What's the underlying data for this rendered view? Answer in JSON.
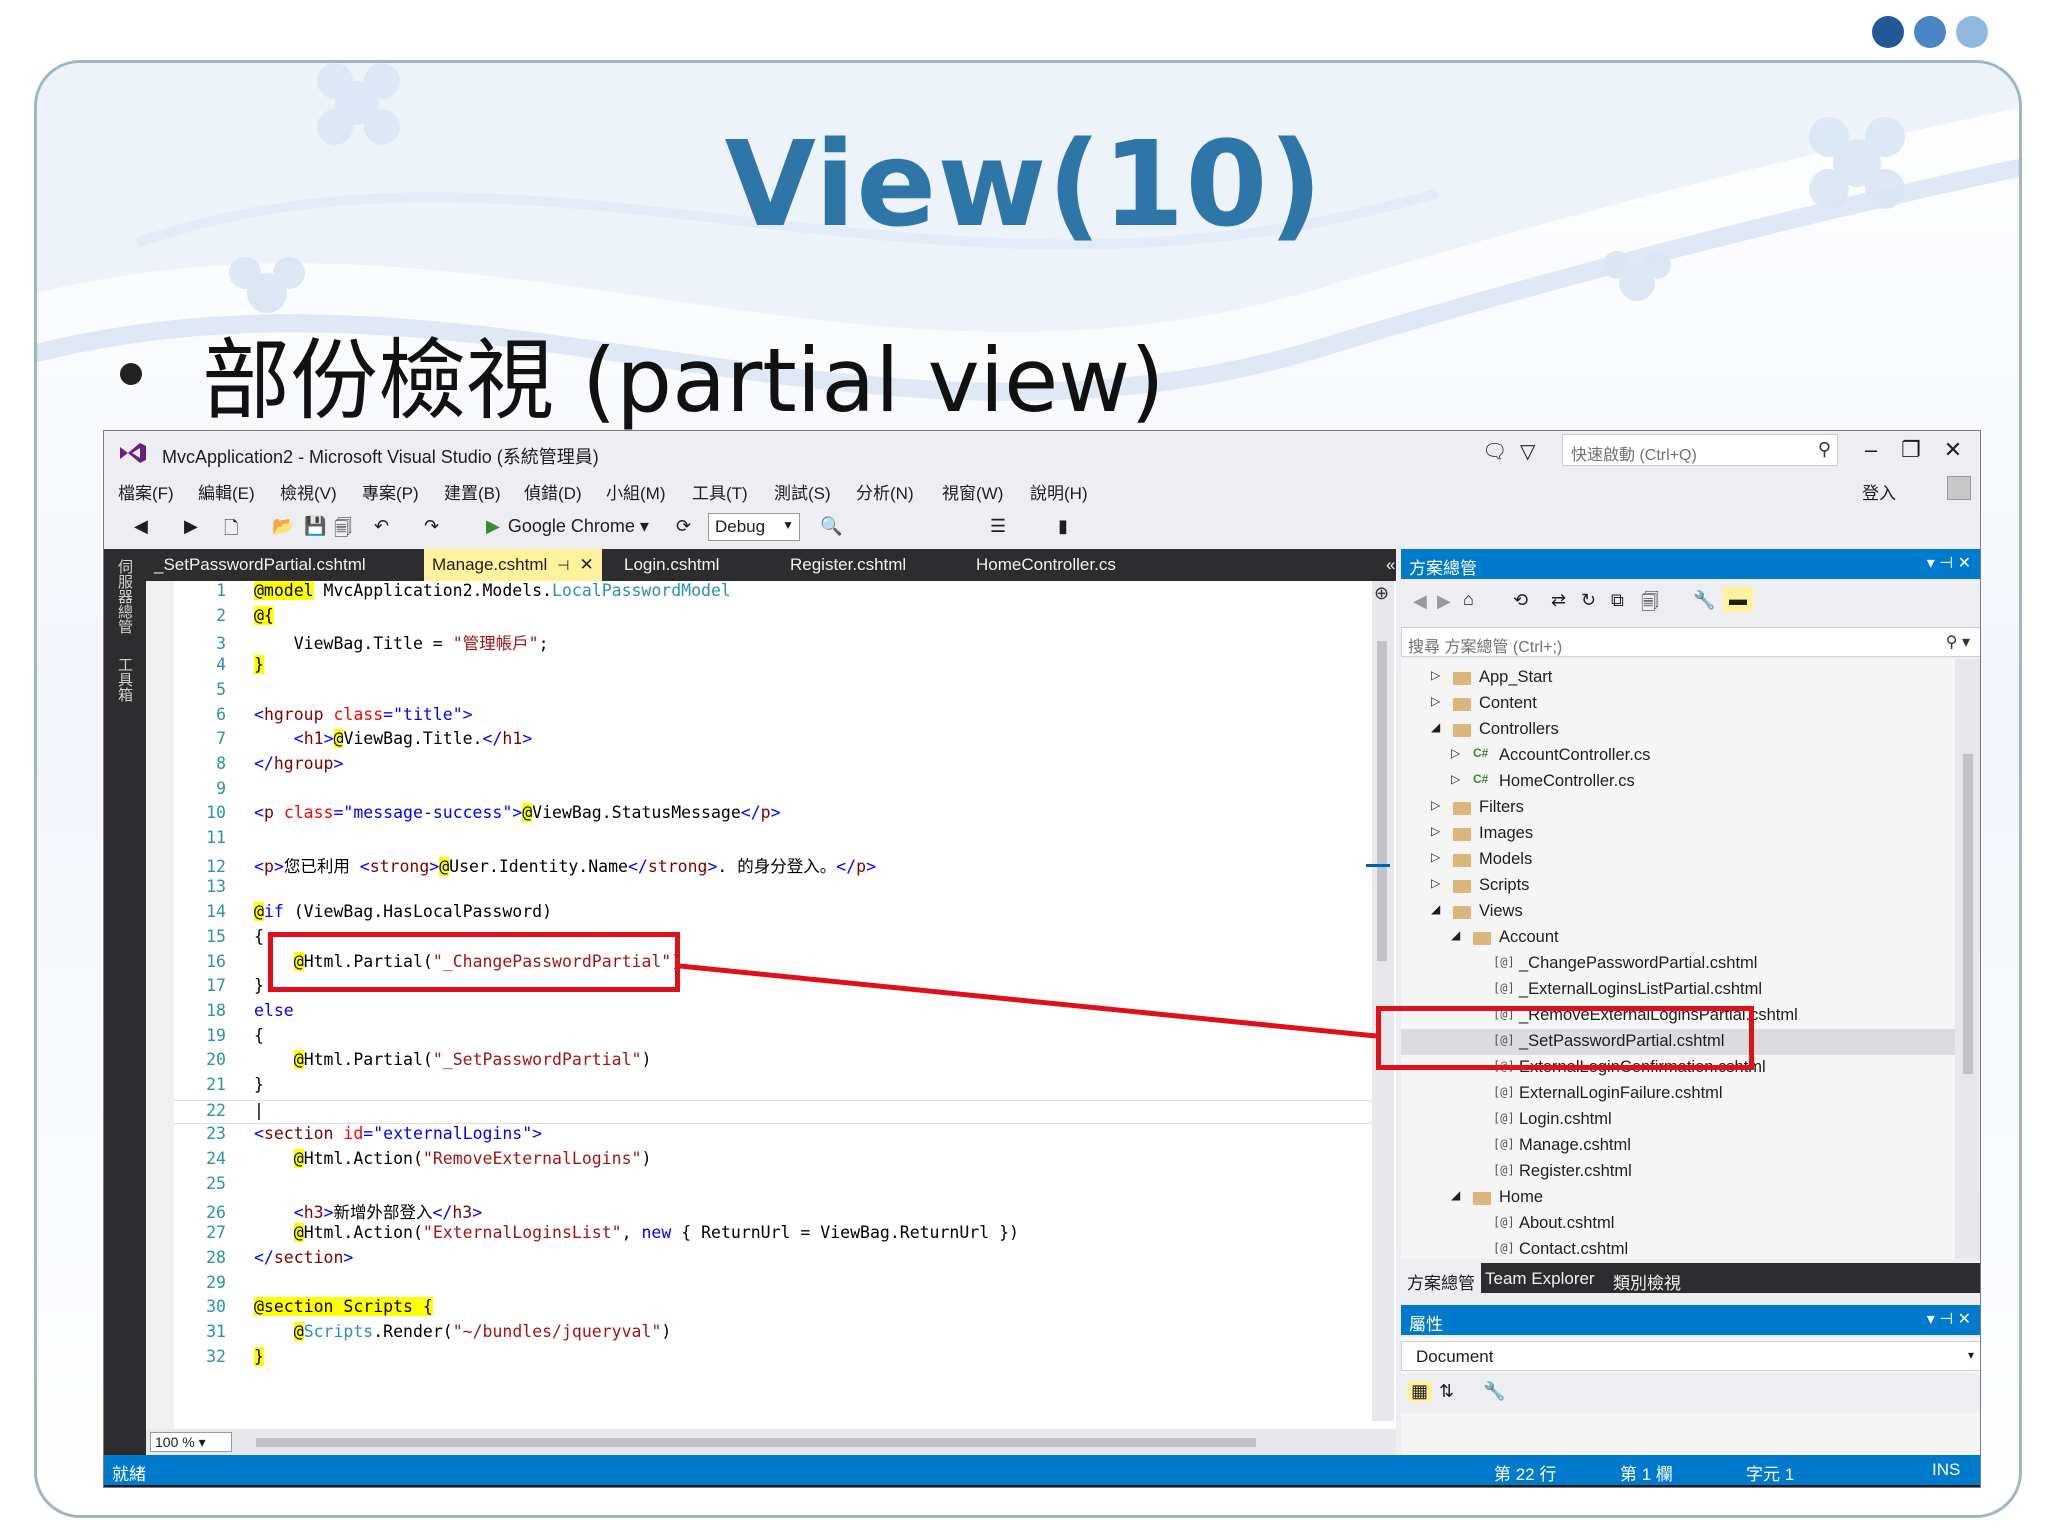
{
  "slide": {
    "title": "View(10)",
    "bullet": "部份檢視 (partial view)",
    "dots_colors": [
      "#1f5a96",
      "#4a86c5",
      "#8fb9e0"
    ]
  },
  "window": {
    "title": "MvcApplication2 - Microsoft Visual Studio (系統管理員)",
    "quick_launch_placeholder": "快速啟動 (Ctrl+Q)",
    "sign_in": "登入",
    "menu": [
      "檔案(F)",
      "編輯(E)",
      "檢視(V)",
      "專案(P)",
      "建置(B)",
      "偵錯(D)",
      "小組(M)",
      "工具(T)",
      "測試(S)",
      "分析(N)",
      "視窗(W)",
      "說明(H)"
    ],
    "toolbar": {
      "run_target": "Google Chrome",
      "configuration": "Debug"
    },
    "left_strip": [
      "伺服器總管",
      "工具箱"
    ]
  },
  "editor": {
    "tabs": [
      "_SetPasswordPartial.cshtml",
      "Manage.cshtml",
      "Login.cshtml",
      "Register.cshtml",
      "HomeController.cs"
    ],
    "active_tab": "Manage.cshtml",
    "zoom": "100 %",
    "lines": {
      "l1": "@model MvcApplication2.Models.LocalPasswordModel",
      "l2": "@{",
      "l3": "    ViewBag.Title = \"管理帳戶\";",
      "l4": "}",
      "l6": "<hgroup class=\"title\">",
      "l7": "    <h1>@ViewBag.Title.</h1>",
      "l8": "</hgroup>",
      "l10": "<p class=\"message-success\">@ViewBag.StatusMessage</p>",
      "l12": "<p>您已利用 <strong>@User.Identity.Name</strong>. 的身分登入。</p>",
      "l14": "@if (ViewBag.HasLocalPassword)",
      "l15": "{",
      "l16": "    @Html.Partial(\"_ChangePasswordPartial\")",
      "l17": "}",
      "l18": "else",
      "l19": "{",
      "l20": "    @Html.Partial(\"_SetPasswordPartial\")",
      "l21": "}",
      "l23": "<section id=\"externalLogins\">",
      "l24": "    @Html.Action(\"RemoveExternalLogins\")",
      "l26": "    <h3>新增外部登入</h3>",
      "l27": "    @Html.Action(\"ExternalLoginsList\", new { ReturnUrl = ViewBag.ReturnUrl })",
      "l28": "</section>",
      "l30": "@section Scripts {",
      "l31": "    @Scripts.Render(\"~/bundles/jqueryval\")",
      "l32": "}"
    }
  },
  "solution_explorer": {
    "title": "方案總管",
    "search_placeholder": "搜尋 方案總管 (Ctrl+;)",
    "items": [
      {
        "label": "App_Start",
        "kind": "folder",
        "level": 0,
        "state": "collapsed"
      },
      {
        "label": "Content",
        "kind": "folder",
        "level": 0,
        "state": "collapsed"
      },
      {
        "label": "Controllers",
        "kind": "folder",
        "level": 0,
        "state": "expanded"
      },
      {
        "label": "AccountController.cs",
        "kind": "cs",
        "level": 1,
        "state": "collapsed"
      },
      {
        "label": "HomeController.cs",
        "kind": "cs",
        "level": 1,
        "state": "collapsed"
      },
      {
        "label": "Filters",
        "kind": "folder",
        "level": 0,
        "state": "collapsed"
      },
      {
        "label": "Images",
        "kind": "folder",
        "level": 0,
        "state": "collapsed"
      },
      {
        "label": "Models",
        "kind": "folder",
        "level": 0,
        "state": "collapsed"
      },
      {
        "label": "Scripts",
        "kind": "folder",
        "level": 0,
        "state": "collapsed"
      },
      {
        "label": "Views",
        "kind": "folder",
        "level": 0,
        "state": "expanded"
      },
      {
        "label": "Account",
        "kind": "folder",
        "level": 1,
        "state": "expanded"
      },
      {
        "label": "_ChangePasswordPartial.cshtml",
        "kind": "cshtml",
        "level": 2,
        "state": "none"
      },
      {
        "label": "_ExternalLoginsListPartial.cshtml",
        "kind": "cshtml",
        "level": 2,
        "state": "none"
      },
      {
        "label": "_RemoveExternalLoginsPartial.cshtml",
        "kind": "cshtml",
        "level": 2,
        "state": "none"
      },
      {
        "label": "_SetPasswordPartial.cshtml",
        "kind": "cshtml",
        "level": 2,
        "state": "selected"
      },
      {
        "label": "ExternalLoginConfirmation.cshtml",
        "kind": "cshtml",
        "level": 2,
        "state": "none"
      },
      {
        "label": "ExternalLoginFailure.cshtml",
        "kind": "cshtml",
        "level": 2,
        "state": "none"
      },
      {
        "label": "Login.cshtml",
        "kind": "cshtml",
        "level": 2,
        "state": "none"
      },
      {
        "label": "Manage.cshtml",
        "kind": "cshtml",
        "level": 2,
        "state": "none"
      },
      {
        "label": "Register.cshtml",
        "kind": "cshtml",
        "level": 2,
        "state": "none"
      },
      {
        "label": "Home",
        "kind": "folder",
        "level": 1,
        "state": "expanded"
      },
      {
        "label": "About.cshtml",
        "kind": "cshtml",
        "level": 2,
        "state": "none"
      },
      {
        "label": "Contact.cshtml",
        "kind": "cshtml",
        "level": 2,
        "state": "none"
      }
    ],
    "bottom_tabs": [
      "方案總管",
      "Team Explorer",
      "類別檢視"
    ]
  },
  "properties": {
    "title": "屬性",
    "selected_object": "Document"
  },
  "status_bar": {
    "ready": "就緒",
    "line": "第 22 行",
    "column": "第 1 欄",
    "char": "字元 1",
    "mode": "INS"
  },
  "colors": {
    "title_blue": "#2e76a8",
    "vs_accent": "#007acc",
    "highlight_red": "#e0101a"
  }
}
